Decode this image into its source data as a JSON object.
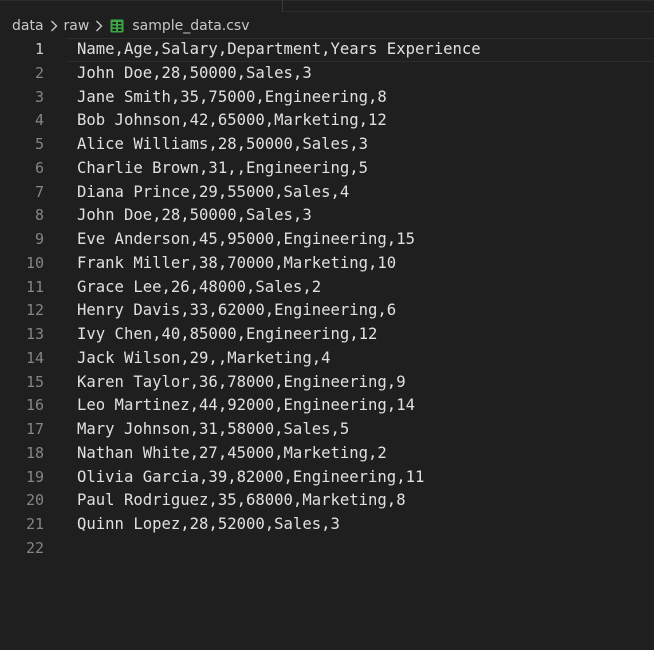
{
  "breadcrumb": {
    "folder1": "data",
    "folder2": "raw",
    "file": "sample_data.csv"
  },
  "colors": {
    "background": "#1f1f1f",
    "csv_icon": "#3da544",
    "line_number": "#858585",
    "text": "#e0e0e0"
  },
  "icons": [
    "chevron-right-icon",
    "csv-file-icon"
  ],
  "editor": {
    "lines": [
      {
        "num": "1",
        "text": "Name,Age,Salary,Department,Years Experience"
      },
      {
        "num": "2",
        "text": "John Doe,28,50000,Sales,3"
      },
      {
        "num": "3",
        "text": "Jane Smith,35,75000,Engineering,8"
      },
      {
        "num": "4",
        "text": "Bob Johnson,42,65000,Marketing,12"
      },
      {
        "num": "5",
        "text": "Alice Williams,28,50000,Sales,3"
      },
      {
        "num": "6",
        "text": "Charlie Brown,31,,Engineering,5"
      },
      {
        "num": "7",
        "text": "Diana Prince,29,55000,Sales,4"
      },
      {
        "num": "8",
        "text": "John Doe,28,50000,Sales,3"
      },
      {
        "num": "9",
        "text": "Eve Anderson,45,95000,Engineering,15"
      },
      {
        "num": "10",
        "text": "Frank Miller,38,70000,Marketing,10"
      },
      {
        "num": "11",
        "text": "Grace Lee,26,48000,Sales,2"
      },
      {
        "num": "12",
        "text": "Henry Davis,33,62000,Engineering,6"
      },
      {
        "num": "13",
        "text": "Ivy Chen,40,85000,Engineering,12"
      },
      {
        "num": "14",
        "text": "Jack Wilson,29,,Marketing,4"
      },
      {
        "num": "15",
        "text": "Karen Taylor,36,78000,Engineering,9"
      },
      {
        "num": "16",
        "text": "Leo Martinez,44,92000,Engineering,14"
      },
      {
        "num": "17",
        "text": "Mary Johnson,31,58000,Sales,5"
      },
      {
        "num": "18",
        "text": "Nathan White,27,45000,Marketing,2"
      },
      {
        "num": "19",
        "text": "Olivia Garcia,39,82000,Engineering,11"
      },
      {
        "num": "20",
        "text": "Paul Rodriguez,35,68000,Marketing,8"
      },
      {
        "num": "21",
        "text": "Quinn Lopez,28,52000,Sales,3"
      },
      {
        "num": "22",
        "text": ""
      }
    ]
  }
}
